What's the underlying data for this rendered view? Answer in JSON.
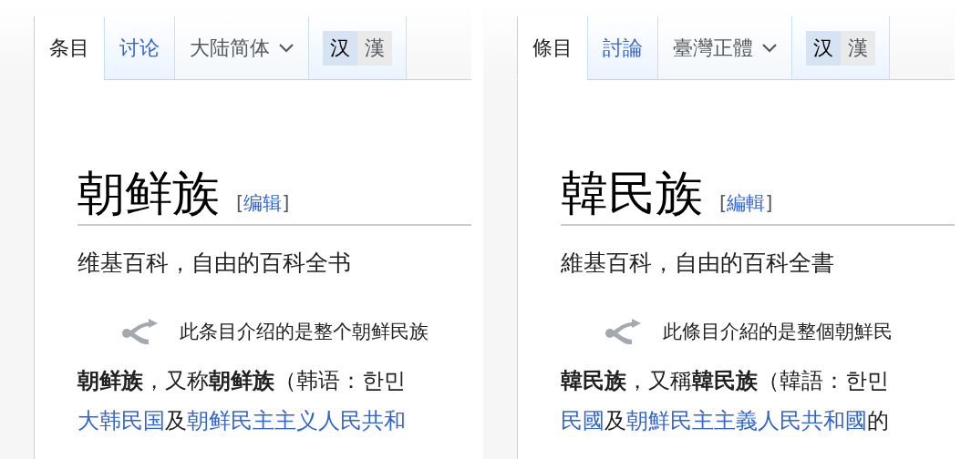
{
  "panels": [
    {
      "tabs": [
        {
          "label": "条目",
          "selected": true
        },
        {
          "label": "讨论",
          "selected": false
        }
      ],
      "variant": {
        "label": "大陆简体"
      },
      "script_toggle": [
        {
          "label": "汉",
          "selected": true
        },
        {
          "label": "漢",
          "selected": false
        }
      ],
      "title": "朝鲜族",
      "edit": {
        "open": "[",
        "label": "编辑",
        "close": "]"
      },
      "tagline": "维基百科，自由的百科全书",
      "hatnote": "此条目介绍的是整个朝鲜民族",
      "lead_line": "**朝鲜族**，又称**朝鲜族**（韩语：한민",
      "link_line": [
        {
          "text": "大韩民国",
          "kind": "link"
        },
        {
          "text": "及",
          "kind": "text"
        },
        {
          "text": "朝鲜民主主义人民共和",
          "kind": "link"
        }
      ]
    },
    {
      "tabs": [
        {
          "label": "條目",
          "selected": true
        },
        {
          "label": "討論",
          "selected": false
        }
      ],
      "variant": {
        "label": "臺灣正體"
      },
      "script_toggle": [
        {
          "label": "汉",
          "selected": true
        },
        {
          "label": "漢",
          "selected": false
        }
      ],
      "title": "韓民族",
      "edit": {
        "open": "[",
        "label": "編輯",
        "close": "]"
      },
      "tagline": "維基百科，自由的百科全書",
      "hatnote": "此條目介紹的是整個朝鮮民",
      "lead_line": "**韓民族**，又稱**韓民族**（韓語：한민",
      "link_line": [
        {
          "text": "民國",
          "kind": "link"
        },
        {
          "text": "及",
          "kind": "text"
        },
        {
          "text": "朝鮮民主主義人民共和國",
          "kind": "link"
        },
        {
          "text": "的",
          "kind": "text"
        }
      ]
    }
  ]
}
